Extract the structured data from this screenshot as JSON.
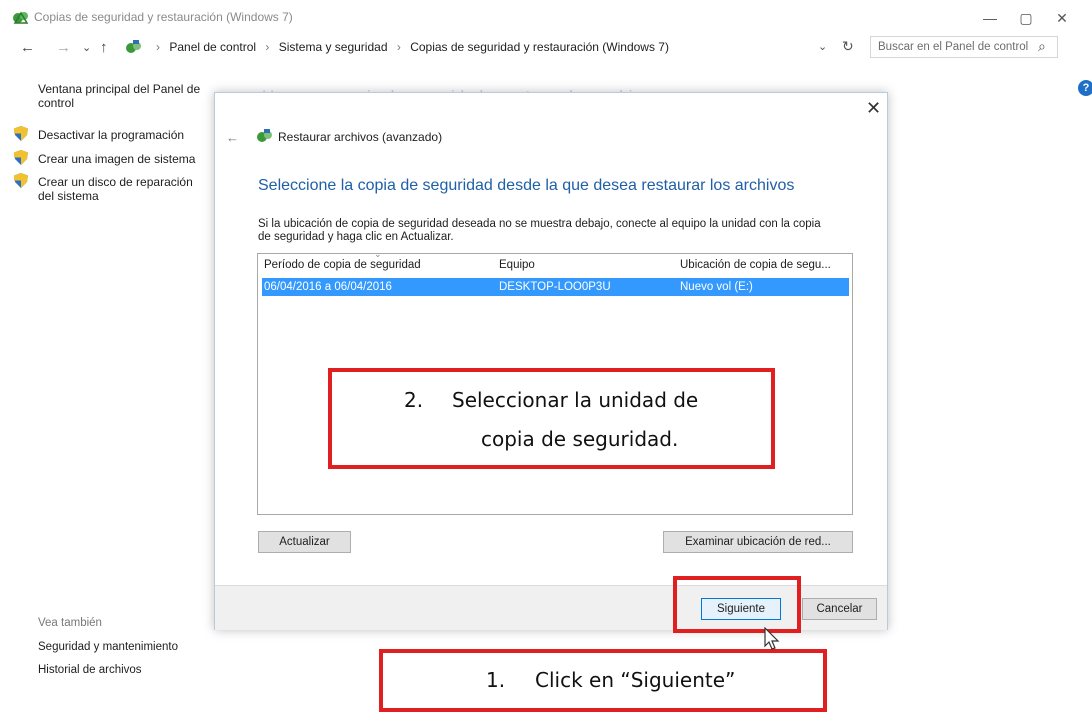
{
  "window": {
    "title": "Copias de seguridad y restauración (Windows 7)",
    "minimize": "—",
    "maximize": "▢",
    "close": "✕"
  },
  "address": {
    "back": "←",
    "forward": "→",
    "dropdown": "⌄",
    "up": "↑",
    "crumbs": [
      "Panel de control",
      "Sistema y seguridad",
      "Copias de seguridad y restauración (Windows 7)"
    ],
    "separator": "›",
    "addr_dropdown": "⌄",
    "refresh": "↻",
    "search_placeholder": "Buscar en el Panel de control",
    "search_icon": "⌕",
    "help": "?"
  },
  "left_pane": {
    "title": "Ventana principal del Panel de control",
    "links": [
      "Desactivar la programación",
      "Crear una imagen de sistema",
      "Crear un disco de reparación del sistema"
    ],
    "see_also": "Vea también",
    "bottom_links": [
      "Seguridad y mantenimiento",
      "Historial de archivos"
    ]
  },
  "background_heading": "Hace una copia de seguridad o restaura los archivos",
  "dialog": {
    "close": "✕",
    "back": "←",
    "title": "Restaurar archivos (avanzado)",
    "heading": "Seleccione la copia de seguridad desde la que desea restaurar los archivos",
    "instructions": "Si la ubicación de copia de seguridad deseada no se muestra debajo, conecte al equipo la unidad con la copia de seguridad y haga clic en Actualizar.",
    "columns": [
      "Período de copia de seguridad",
      "Equipo",
      "Ubicación de copia de segu..."
    ],
    "sort_glyph": "⌄",
    "rows": [
      {
        "period": "06/04/2016 a 06/04/2016",
        "computer": "DESKTOP-LOO0P3U",
        "location": "Nuevo vol (E:)"
      }
    ],
    "refresh_button": "Actualizar",
    "browse_button": "Examinar ubicación de red...",
    "next_button": "Siguiente",
    "cancel_button": "Cancelar"
  },
  "annotations": {
    "step2_number": "2.",
    "step2_line1": "Seleccionar la unidad de",
    "step2_line2": "copia de seguridad.",
    "step1_number": "1.",
    "step1_text": "Click en “Siguiente”",
    "accent_color": "#e02020"
  }
}
